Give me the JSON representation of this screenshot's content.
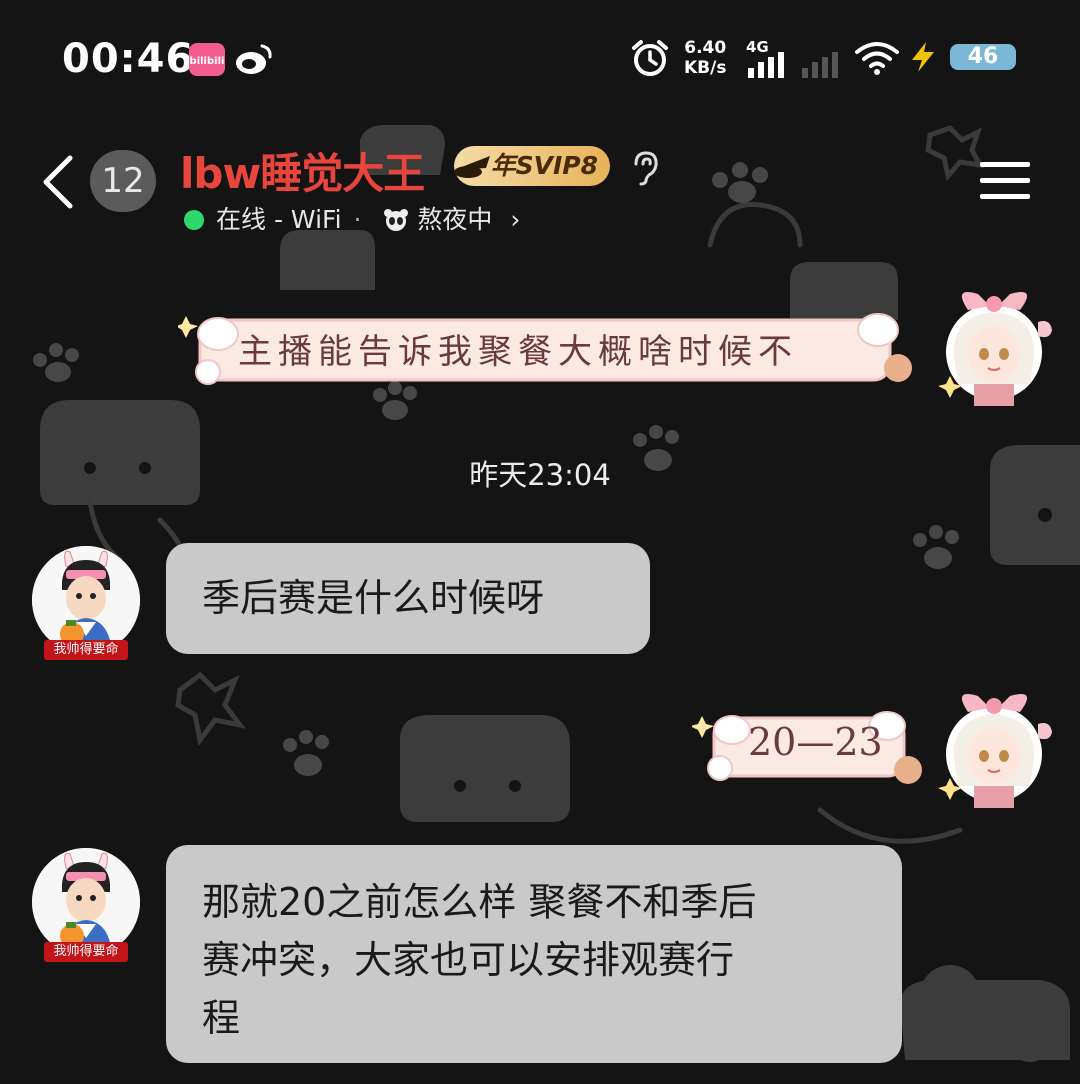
{
  "status_bar": {
    "time": "00:46",
    "net_speed_value": "6.40",
    "net_speed_unit": "KB/s",
    "signal_label": "4G",
    "battery": "46",
    "app_icons": [
      "bilibili-icon",
      "weibo-icon"
    ],
    "bilibili_text": "bilibili"
  },
  "header": {
    "unread_count": "12",
    "contact_name": "lbw睡觉大王",
    "vip_badge": "年SVIP8",
    "online_status": "在线 - WiFi",
    "separator": "·",
    "activity_status": "熬夜中",
    "chevron": "›"
  },
  "messages": [
    {
      "side": "right",
      "style": "decorated",
      "text": "主播能告诉我聚餐大概啥时候不"
    },
    {
      "type": "timestamp",
      "text": "昨天23:04"
    },
    {
      "side": "left",
      "avatar_tag": "我帅得要命",
      "text": "季后赛是什么时候呀"
    },
    {
      "side": "right",
      "style": "decorated",
      "text": "20—23"
    },
    {
      "side": "left",
      "avatar_tag": "我帅得要命",
      "lines": [
        "那就20之前怎么样 聚餐不和季后",
        "赛冲突，大家也可以安排观赛行",
        "程"
      ]
    }
  ],
  "colors": {
    "background": "#141414",
    "contact_name": "#e8453c",
    "online_dot": "#2fd86b",
    "bubble_left": "#c9c9c9",
    "decorated_bubble": "#fbe9e4",
    "battery": "#7ab8d6"
  }
}
